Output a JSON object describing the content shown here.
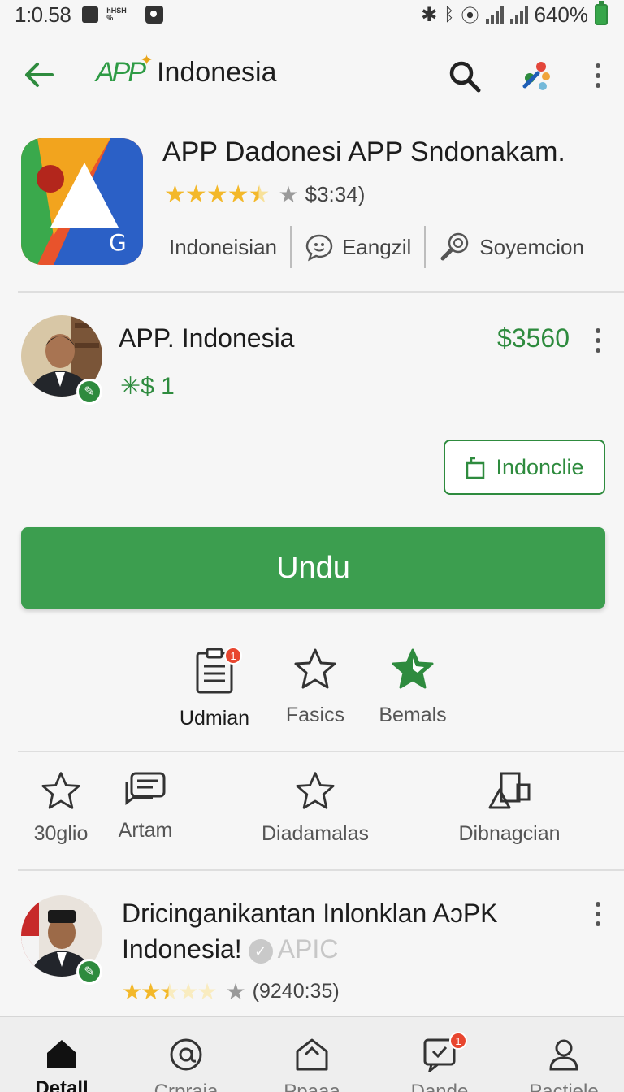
{
  "status_bar": {
    "time": "1:0.58",
    "tiny_label": "hHSH %",
    "battery": "640%"
  },
  "app_bar": {
    "brand_logo": "APP",
    "brand_name": "Indonesia",
    "icons": [
      "back-arrow-icon",
      "search-icon",
      "assistant-icon",
      "more-vert-icon"
    ]
  },
  "app": {
    "title": "APP Dadonesi APP Sndonakam.",
    "rating_value": 4.5,
    "rating_text": "$3:34)",
    "meta": [
      {
        "label": "Indoneisian",
        "icon": ""
      },
      {
        "label": "Eangzil",
        "icon": "chat-bubble-icon"
      },
      {
        "label": "Soyemcion",
        "icon": "search-tool-icon"
      }
    ]
  },
  "developer": {
    "name": "APP. Indonesia",
    "sub": "✳$ 1",
    "price": "$3560"
  },
  "outline_button": {
    "label": "Indonclie",
    "icon": "bag-icon"
  },
  "primary_button": {
    "label": "Undu"
  },
  "quick_actions": [
    {
      "label": "Udmian",
      "icon": "clipboard-icon",
      "badge": "1",
      "active": true
    },
    {
      "label": "Fasics",
      "icon": "star-outline-icon"
    },
    {
      "label": "Bemals",
      "icon": "green-star-icon"
    }
  ],
  "stats": [
    {
      "label": "30ɡlio",
      "icon": "star-outline-icon"
    },
    {
      "label": "Artam",
      "icon": "message-icon"
    },
    {
      "label": "Diadamalas",
      "icon": "star-outline-icon"
    },
    {
      "label": "Dibnagcian",
      "icon": "shapes-icon"
    }
  ],
  "review": {
    "title_line1": "Dricinganikantan Inlonklan AɔPK",
    "title_line2": "Indonesia!",
    "title_faded": "APIC",
    "rating_value": 2.5,
    "rating_text": "(9240:35)"
  },
  "bottom_nav": [
    {
      "label": "Detall",
      "icon": "home-icon",
      "active": true
    },
    {
      "label": "Crpraia",
      "icon": "at-icon"
    },
    {
      "label": "Ppaaa",
      "icon": "store-icon"
    },
    {
      "label": "Dande",
      "icon": "message-heart-icon",
      "badge": "1"
    },
    {
      "label": "Pactiele",
      "icon": "profile-icon"
    }
  ],
  "colors": {
    "accent": "#2e8b3e",
    "primary_button": "#3c9e4f",
    "star": "#f3b82a",
    "badge": "#e8462f"
  }
}
